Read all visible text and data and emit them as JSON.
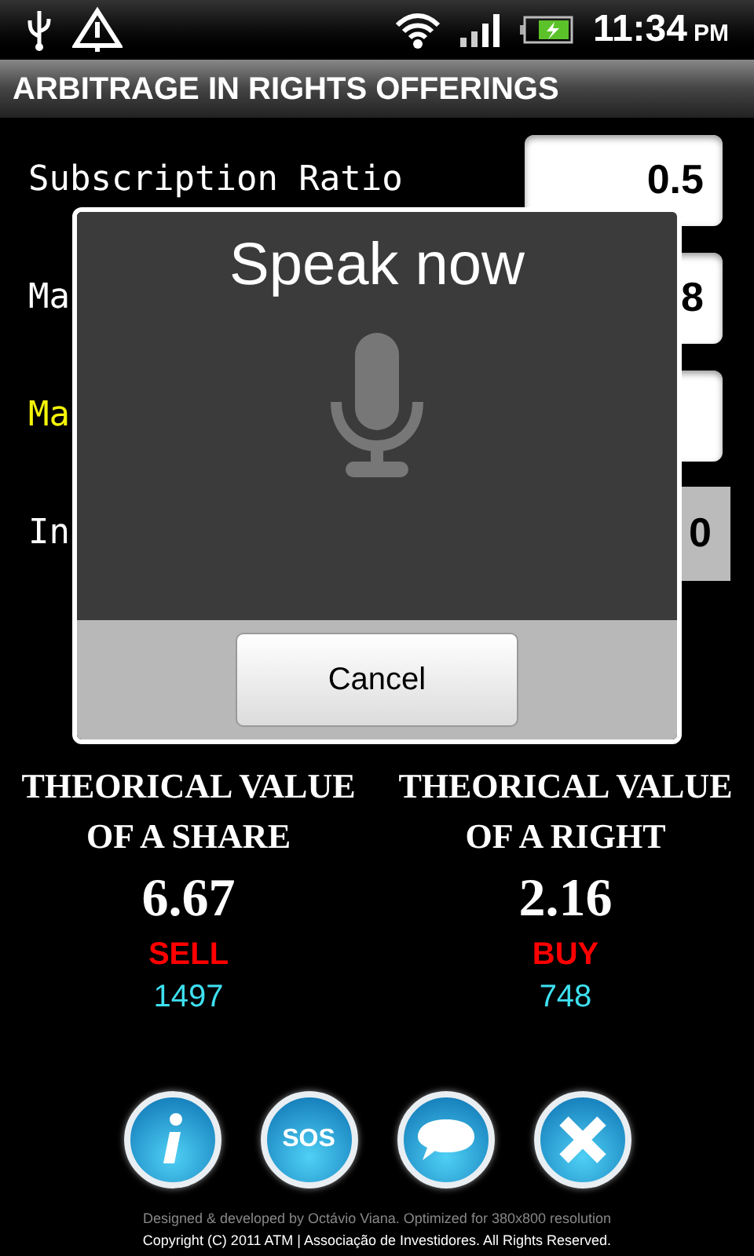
{
  "status_bar": {
    "time": "11:34",
    "ampm": "PM"
  },
  "title": "ARBITRAGE IN RIGHTS OFFERINGS",
  "fields": [
    {
      "label": "Subscription Ratio",
      "value": "0.5",
      "focused": false,
      "disabled": false
    },
    {
      "label": "Ma",
      "value": "8",
      "focused": false,
      "disabled": false
    },
    {
      "label": "Ma",
      "focused": true,
      "disabled": false
    },
    {
      "label": "In",
      "value": "0",
      "focused": false,
      "disabled": true
    }
  ],
  "results": [
    {
      "title": "THEORICAL VALUE OF A SHARE",
      "value": "6.67",
      "action": "SELL",
      "quantity": "1497"
    },
    {
      "title": "THEORICAL VALUE OF A RIGHT",
      "value": "2.16",
      "action": "BUY",
      "quantity": "748"
    }
  ],
  "buttons": [
    {
      "kind": "info"
    },
    {
      "kind": "sos",
      "label": "SOS"
    },
    {
      "kind": "chat"
    },
    {
      "kind": "close"
    }
  ],
  "footer": [
    "Designed & developed by Octávio Viana. Optimized for 380x800 resolution",
    "Copyright (C) 2011 ATM | Associação de Investidores. All Rights Reserved."
  ],
  "dialog": {
    "title": "Speak now",
    "button": "Cancel"
  }
}
